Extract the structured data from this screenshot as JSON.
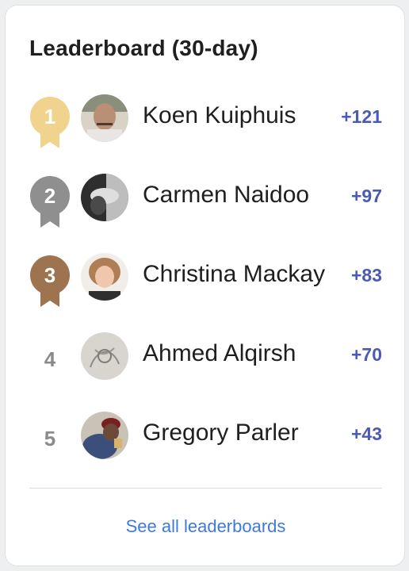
{
  "leaderboard": {
    "title": "Leaderboard (30-day)",
    "colors": {
      "gold": "#f0d38c",
      "silver": "#8f8f8f",
      "bronze": "#9e7450",
      "score": "#4b5bb3",
      "link": "#3f78df"
    },
    "entries": [
      {
        "rank": "1",
        "name": "Koen Kuiphuis",
        "score": "+121",
        "badge": "gold-ribbon-icon"
      },
      {
        "rank": "2",
        "name": "Carmen Naidoo",
        "score": "+97",
        "badge": "silver-ribbon-icon"
      },
      {
        "rank": "3",
        "name": "Christina Mackay",
        "score": "+83",
        "badge": "bronze-ribbon-icon"
      },
      {
        "rank": "4",
        "name": "Ahmed Alqirsh",
        "score": "+70"
      },
      {
        "rank": "5",
        "name": "Gregory Parler",
        "score": "+43"
      }
    ],
    "see_all_label": "See all leaderboards"
  }
}
